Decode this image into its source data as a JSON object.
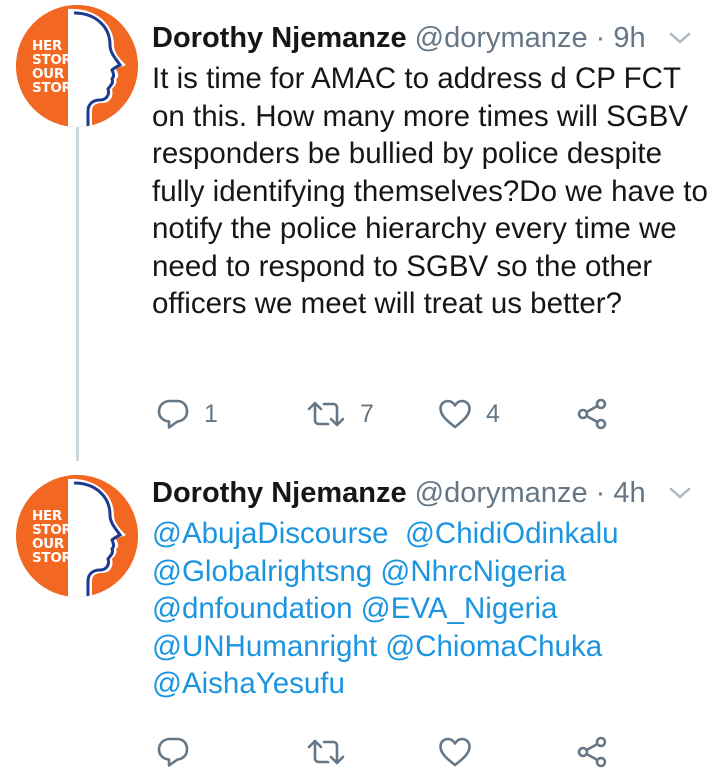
{
  "tweets": [
    {
      "avatar": {
        "lines": [
          "HER",
          "STORY",
          "OUR",
          "STORY"
        ],
        "bg_color": "#f26722",
        "silhouette_color": "#ffffff",
        "ring_color": "#1d3a8f"
      },
      "author_name": "Dorothy Njemanze",
      "handle": "@dorymanze",
      "separator": "·",
      "time": "9h",
      "menu_icon": "chevron-down-icon",
      "text": "It is time for AMAC to address d CP FCT on this. How many more times will SGBV responders be bullied by police despite fully identifying themselves?Do we have to notify the police hierarchy every time we need to respond to SGBV so the other officers we meet will treat us better?",
      "actions": {
        "reply_count": "1",
        "retweet_count": "7",
        "like_count": "4"
      }
    },
    {
      "avatar": {
        "lines": [
          "HER",
          "STORY",
          "OUR",
          "STORY"
        ],
        "bg_color": "#f26722",
        "silhouette_color": "#ffffff",
        "ring_color": "#1d3a8f"
      },
      "author_name": "Dorothy Njemanze",
      "handle": "@dorymanze",
      "separator": "·",
      "time": "4h",
      "menu_icon": "chevron-down-icon",
      "mentions": [
        "@AbujaDiscourse",
        "@ChidiOdinkalu",
        "@Globalrightsng",
        "@NhrcNigeria",
        "@dnfoundation",
        "@EVA_Nigeria",
        "@UNHumanright",
        "@ChiomaChuka",
        "@AishaYesufu"
      ],
      "actions": {
        "reply_count": "",
        "retweet_count": "",
        "like_count": ""
      }
    }
  ],
  "colors": {
    "text": "#14171a",
    "secondary": "#657786",
    "mention": "#1b95e0",
    "thread_line": "#ccd6dd"
  },
  "icons": [
    "reply-icon",
    "retweet-icon",
    "like-icon",
    "share-icon",
    "chevron-down-icon"
  ]
}
